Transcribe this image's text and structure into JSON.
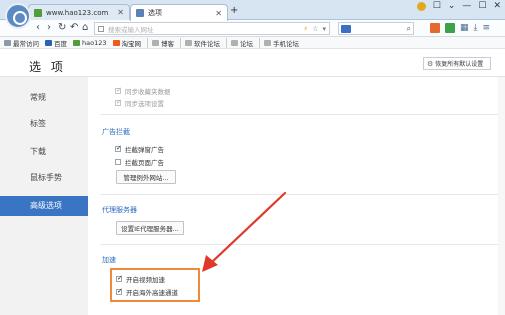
{
  "tabs": [
    {
      "title": "www.hao123.com",
      "favicon_color": "#4f9e3a"
    },
    {
      "title": "选项",
      "favicon_color": "#5b7fb8"
    }
  ],
  "window_controls": [
    "☐",
    "⌄",
    "—",
    "☐",
    "✕"
  ],
  "nav": {
    "back": "‹",
    "forward": "›",
    "refresh": "↻",
    "undo": "↶",
    "home": "⌂",
    "favorite": "☆",
    "address_placeholder": "搜索或输入网址",
    "address_actions": [
      "⚡",
      "☆",
      "▾"
    ],
    "search_icon": "⌕",
    "search_logo": "百度"
  },
  "bookmarks": [
    {
      "label": "最常访问",
      "color": "#8e9aab"
    },
    {
      "label": "百度",
      "color": "#2e5fb8"
    },
    {
      "label": "hao123",
      "color": "#4f9e3a"
    },
    {
      "label": "淘宝网",
      "color": "#f05a1c"
    },
    {
      "label": "博客",
      "color": "#b0b0b0"
    },
    {
      "label": "软件论坛",
      "color": "#b0b0b0"
    },
    {
      "label": "论坛",
      "color": "#b0b0b0"
    },
    {
      "label": "手机论坛",
      "color": "#b0b0b0"
    }
  ],
  "page": {
    "title": "选 项",
    "restore_button": "恢复所有默认设置",
    "restore_icon": "⚙"
  },
  "sidebar": {
    "items": [
      {
        "label": "常规",
        "active": false
      },
      {
        "label": "标签",
        "active": false
      },
      {
        "label": "下载",
        "active": false
      },
      {
        "label": "鼠标手势",
        "active": false
      },
      {
        "label": "高级选项",
        "active": true
      }
    ]
  },
  "sync": {
    "items": [
      {
        "label": "同步收藏夹数据",
        "checked": true
      },
      {
        "label": "同步选项设置",
        "checked": true
      }
    ]
  },
  "adblock": {
    "title": "广告拦截",
    "items": [
      {
        "label": "拦截弹窗广告",
        "checked": true
      },
      {
        "label": "拦截页面广告",
        "checked": false
      }
    ],
    "button": "管理例外网站..."
  },
  "proxy": {
    "title": "代理服务器",
    "button": "设置IE代理服务器..."
  },
  "accelerate": {
    "title": "加速",
    "items": [
      {
        "label": "开启视频加速",
        "checked": true
      },
      {
        "label": "开启海外高速通道",
        "checked": true
      }
    ]
  },
  "colors": {
    "accent": "#3a75c4",
    "highlight": "#ef8a3a",
    "arrow": "#e0392b"
  }
}
